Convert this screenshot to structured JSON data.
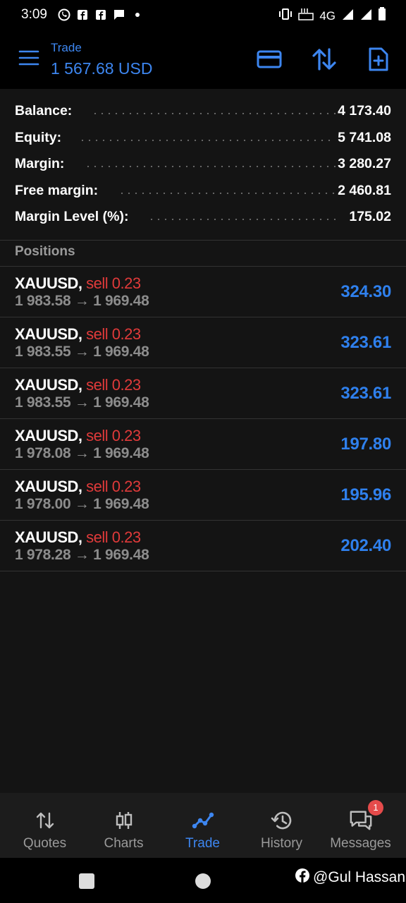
{
  "status_bar": {
    "time": "3:09",
    "network": "4G"
  },
  "app_bar": {
    "title": "Trade",
    "subtitle": "1 567.68 USD"
  },
  "summary": [
    {
      "label": "Balance:",
      "value": "4 173.40"
    },
    {
      "label": "Equity:",
      "value": "5 741.08"
    },
    {
      "label": "Margin:",
      "value": "3 280.27"
    },
    {
      "label": "Free margin:",
      "value": "2 460.81"
    },
    {
      "label": "Margin Level (%):",
      "value": "175.02"
    }
  ],
  "positions_header": "Positions",
  "positions": [
    {
      "symbol": "XAUUSD,",
      "side": "sell 0.23",
      "prices": "1 983.58 → 1 969.48",
      "profit": "324.30"
    },
    {
      "symbol": "XAUUSD,",
      "side": "sell 0.23",
      "prices": "1 983.55 → 1 969.48",
      "profit": "323.61"
    },
    {
      "symbol": "XAUUSD,",
      "side": "sell 0.23",
      "prices": "1 983.55 → 1 969.48",
      "profit": "323.61"
    },
    {
      "symbol": "XAUUSD,",
      "side": "sell 0.23",
      "prices": "1 978.08 → 1 969.48",
      "profit": "197.80"
    },
    {
      "symbol": "XAUUSD,",
      "side": "sell 0.23",
      "prices": "1 978.00 → 1 969.48",
      "profit": "195.96"
    },
    {
      "symbol": "XAUUSD,",
      "side": "sell 0.23",
      "prices": "1 978.28 → 1 969.48",
      "profit": "202.40"
    }
  ],
  "bottom_nav": {
    "items": [
      {
        "label": "Quotes",
        "icon": "quotes-arrows-icon"
      },
      {
        "label": "Charts",
        "icon": "candlestick-icon"
      },
      {
        "label": "Trade",
        "icon": "trade-line-icon",
        "active": true
      },
      {
        "label": "History",
        "icon": "history-icon"
      },
      {
        "label": "Messages",
        "icon": "chat-icon"
      }
    ],
    "messages_badge": "1"
  },
  "watermark": "@Gul Hassan",
  "colors": {
    "accent": "#3d86f0",
    "profit": "#2f80ed",
    "sell": "#e03a3a",
    "background": "#141414",
    "bar": "#000000"
  }
}
